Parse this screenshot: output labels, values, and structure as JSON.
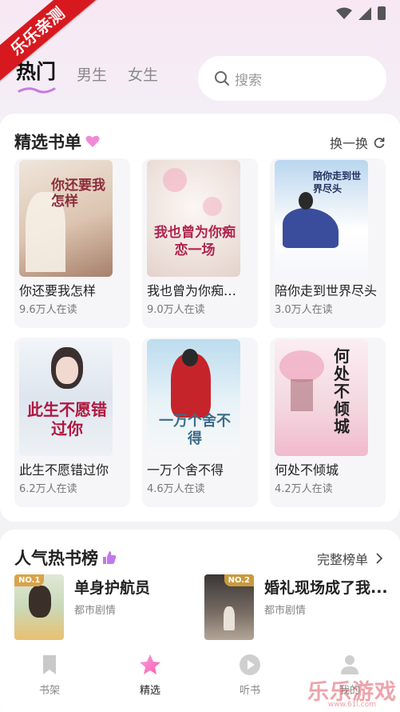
{
  "ribbon": "乐乐亲测",
  "tabs": [
    "热门",
    "男生",
    "女生"
  ],
  "search": {
    "placeholder": "搜索"
  },
  "featured": {
    "title": "精选书单",
    "action": "换一换",
    "books": [
      {
        "title": "你还要我怎样",
        "reads": "9.6万人在读",
        "cover_text": "你还要我怎样",
        "cover_colors": [
          "#e9dccf",
          "#b98a73"
        ]
      },
      {
        "title": "我也曾为你痴恋一场",
        "reads": "9.0万人在读",
        "cover_text": "我也曾为你痴恋一场",
        "cover_colors": [
          "#f3eee9",
          "#d7c8c2"
        ]
      },
      {
        "title": "陪你走到世界尽头",
        "reads": "3.0万人在读",
        "cover_text": "陪你走到世界尽头",
        "cover_colors": [
          "#c9dff3",
          "#5a6fb0"
        ]
      },
      {
        "title": "此生不愿错过你",
        "reads": "6.2万人在读",
        "cover_text": "此生不愿错过你",
        "cover_colors": [
          "#eef2f7",
          "#a7b6c8"
        ]
      },
      {
        "title": "一万个舍不得",
        "reads": "4.6万人在读",
        "cover_text": "一万个舍不得",
        "cover_colors": [
          "#cfe4ef",
          "#e5a0a0"
        ]
      },
      {
        "title": "何处不倾城",
        "reads": "4.2万人在读",
        "cover_text": "何处不倾城",
        "cover_colors": [
          "#f7e4ea",
          "#e8a7bd"
        ]
      }
    ]
  },
  "ranking": {
    "title": "人气热书榜",
    "action": "完整榜单",
    "items": [
      {
        "badge": "NO.1",
        "title": "单身护航员",
        "genre": "都市剧情"
      },
      {
        "badge": "NO.2",
        "title": "婚礼现场成了我...",
        "genre": "都市剧情"
      }
    ]
  },
  "nav": [
    {
      "label": "书架",
      "icon": "bookshelf-icon",
      "active": false
    },
    {
      "label": "精选",
      "icon": "star-icon",
      "active": true
    },
    {
      "label": "听书",
      "icon": "play-icon",
      "active": false
    },
    {
      "label": "我的",
      "icon": "user-icon",
      "active": false
    }
  ],
  "watermark": "乐乐游戏",
  "watermark_sub": "www.61l.com",
  "colors": {
    "accent_pink": "#f08ad6",
    "ribbon_red": "#d7191f",
    "badge_gold": "#d99a3a"
  }
}
